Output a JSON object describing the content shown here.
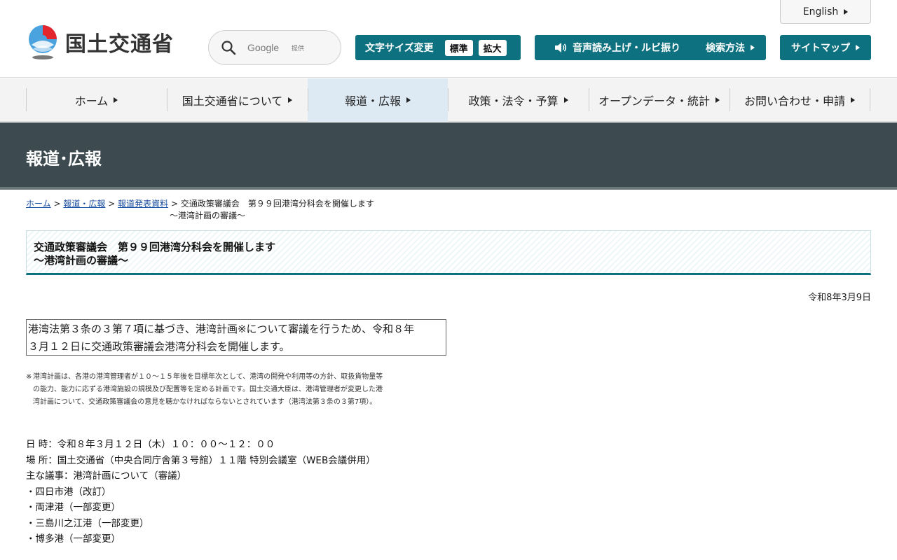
{
  "header": {
    "site_name": "国土交通省",
    "search": {
      "placeholder": "Google",
      "provided": "提供"
    },
    "english": "English",
    "font_size": {
      "label": "文字サイズ変更",
      "standard": "標準",
      "large": "拡大"
    },
    "read_aloud": "音声読み上げ・ルビ振り",
    "search_method": "検索方法",
    "sitemap": "サイトマップ"
  },
  "nav": {
    "items": [
      {
        "label": "ホーム"
      },
      {
        "label": "国土交通省について"
      },
      {
        "label": "報道・広報"
      },
      {
        "label": "政策・法令・予算"
      },
      {
        "label": "オープンデータ・統計"
      },
      {
        "label": "お問い合わせ・申請"
      }
    ],
    "active_index": 2
  },
  "section_title": "報道･広報",
  "breadcrumb": {
    "home": "ホーム",
    "news": "報道・広報",
    "press": "報道発表資料",
    "sep": ">",
    "current_line1": "交通政策審議会　第９９回港湾分科会を開催します",
    "current_line2": "～港湾計画の審議～"
  },
  "article": {
    "title_line1": "交通政策審議会　第９９回港湾分科会を開催します",
    "title_line2": "～港湾計画の審議～",
    "date": "令和8年3月9日",
    "summary_line1": "港湾法第３条の３第７項に基づき、港湾計画※について審議を行うため、令和８年",
    "summary_line2": "３月１２日に交通政策審議会港湾分科会を開催します。",
    "note_mark": "※",
    "note_text": "港湾計画は、各港の港湾管理者が１０～１５年後を目標年次として、港湾の開発や利用等の方針、取扱貨物量等の能力、能力に応ずる港湾施設の規模及び配置等を定める計画です。国土交通大臣は、港湾管理者が変更した港湾計画について、交通政策審議会の意見を聴かなければならないとされています（港湾法第３条の３第7項）。",
    "details": [
      "日 時：令和８年３月１２日（木）１０：００～１２：００",
      "場 所：国土交通省（中央合同庁舎第３号館）１１階 特別会議室（WEB会議併用）",
      "主な議事：港湾計画について（審議）",
      "・四日市港（改訂）",
      "・両津港（一部変更）",
      "・三島川之江港（一部変更）",
      "・博多港（一部変更）"
    ]
  },
  "colors": {
    "teal": "#0e7180",
    "banner": "#3d4a50",
    "nav_active": "#dde9f3",
    "link": "#1b4fa0"
  }
}
